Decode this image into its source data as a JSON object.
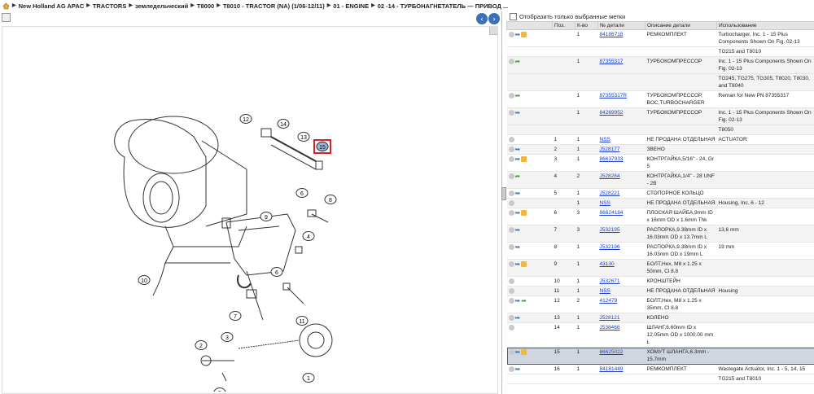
{
  "breadcrumb": [
    "New Holland AG APAC",
    "TRACTORS",
    "земледельческий",
    "T8000",
    "T8010 - TRACTOR (NA) (1/06-12/11)",
    "01 - ENGINE",
    "02 -14 - ТУРБОНАГНЕТАТЕЛЬ — ПРИВОД ..."
  ],
  "filter_label": "Отобразить только выбранные метки",
  "columns": [
    "",
    "Поз.",
    "К-во",
    "№ детали",
    "Описание детали",
    "Использование"
  ],
  "colors": {
    "selected_border": "#e02020",
    "link": "#1a3fd1",
    "nav_btn": "#3b6fb6"
  },
  "rows": [
    {
      "icons": [
        "circle",
        "arrow",
        "cart"
      ],
      "pos": "",
      "qty": "1",
      "part": "84186718",
      "desc": "РЕМКОМПЛЕКТ",
      "use": "Turbocharger, Inc. 1 - 15 Plus Components Shown On Fig. 02-13"
    },
    {
      "icons": [],
      "pos": "",
      "qty": "",
      "part": "",
      "desc": "",
      "use": "TG215 and T8010"
    },
    {
      "icons": [
        "circle",
        "garrow"
      ],
      "pos": "",
      "qty": "1",
      "part": "87355317",
      "desc": "ТУРБОКОМПРЕССОР",
      "use": "Inc. 1 - 15 Plus Components Shown On Fig. 02-13"
    },
    {
      "icons": [],
      "pos": "",
      "qty": "",
      "part": "",
      "desc": "",
      "use": "TG245, TG275, TG305, T8020, T8030, and T8040"
    },
    {
      "icons": [
        "circle",
        "garrow"
      ],
      "pos": "",
      "qty": "1",
      "part": "87355317R",
      "desc": "ТУРБОКОМПРЕССОР, BOC,TURBOCHARGER",
      "use": "Reman for New PN 87355317"
    },
    {
      "icons": [
        "circle",
        "arrow"
      ],
      "pos": "",
      "qty": "1",
      "part": "84269952",
      "desc": "ТУРБОКОМПРЕССОР",
      "use": "Inc. 1 - 15 Plus Components Shown On Fig. 02-13"
    },
    {
      "icons": [],
      "pos": "",
      "qty": "",
      "part": "",
      "desc": "",
      "use": "T8050"
    },
    {
      "icons": [
        "circle"
      ],
      "pos": "1",
      "qty": "1",
      "part": "NSS",
      "desc": "НЕ ПРОДАНА ОТДЕЛЬНАЯ",
      "use": "ACTUATOR"
    },
    {
      "icons": [
        "circle",
        "arrow"
      ],
      "pos": "2",
      "qty": "1",
      "part": "J528177",
      "desc": "ЗВЕНО",
      "use": ""
    },
    {
      "icons": [
        "circle",
        "arrow",
        "cart"
      ],
      "pos": "3",
      "qty": "1",
      "part": "86637933",
      "desc": "КОНТРГАЙКА,5/16\" - 24, Gr 5",
      "use": ""
    },
    {
      "icons": [
        "circle",
        "garrow"
      ],
      "pos": "4",
      "qty": "2",
      "part": "J528284",
      "desc": "КОНТРГАЙКА,1/4\" - 28 UNF - 2B",
      "use": ""
    },
    {
      "icons": [
        "circle",
        "arrow"
      ],
      "pos": "5",
      "qty": "1",
      "part": "J528221",
      "desc": "СТОПОРНОЕ КОЛЬЦО",
      "use": ""
    },
    {
      "icons": [
        "circle"
      ],
      "pos": "",
      "qty": "1",
      "part": "NSS",
      "desc": "НЕ ПРОДАНА ОТДЕЛЬНАЯ",
      "use": "Housing, Inc. 6 - 12"
    },
    {
      "icons": [
        "circle",
        "arrow",
        "cart"
      ],
      "pos": "6",
      "qty": "3",
      "part": "86624184",
      "desc": "ПЛОСКАЯ ШАЙБА,9mm ID x 16mm OD x 1.6mm Thk",
      "use": ""
    },
    {
      "icons": [
        "circle",
        "arrow"
      ],
      "pos": "7",
      "qty": "3",
      "part": "J532195",
      "desc": "РАСПОРКА,9.38mm ID x 16.03mm OD x 13.7mm L",
      "use": "13,6 mm"
    },
    {
      "icons": [
        "circle",
        "arrow"
      ],
      "pos": "8",
      "qty": "1",
      "part": "J532196",
      "desc": "РАСПОРКА,9.38mm ID x 16.03mm OD x 19mm L",
      "use": "19 mm"
    },
    {
      "icons": [
        "circle",
        "arrow",
        "cart"
      ],
      "pos": "9",
      "qty": "1",
      "part": "43130",
      "desc": "БОЛТ,Hex, M8 x 1.25 x 50mm, Cl 8.8",
      "use": ""
    },
    {
      "icons": [
        "circle"
      ],
      "pos": "10",
      "qty": "1",
      "part": "J532671",
      "desc": "КРОНШТЕЙН",
      "use": ""
    },
    {
      "icons": [
        "circle"
      ],
      "pos": "11",
      "qty": "1",
      "part": "NSS",
      "desc": "НЕ ПРОДАНА ОТДЕЛЬНАЯ",
      "use": "Housing"
    },
    {
      "icons": [
        "circle",
        "arrow",
        "garrow"
      ],
      "pos": "12",
      "qty": "2",
      "part": "412479",
      "desc": "БОЛТ,Hex, M8 x 1.25 x 35mm, Cl 8.8",
      "use": ""
    },
    {
      "icons": [
        "circle",
        "arrow"
      ],
      "pos": "13",
      "qty": "1",
      "part": "J528121",
      "desc": "КОЛЕНО",
      "use": ""
    },
    {
      "icons": [
        "circle"
      ],
      "pos": "14",
      "qty": "1",
      "part": "J538468",
      "desc": "ШЛАНГ,6.60mm ID x 12.05mm OD x 1000.00 mm L",
      "use": ""
    },
    {
      "icons": [
        "circle",
        "arrow",
        "cart"
      ],
      "pos": "15",
      "qty": "1",
      "part": "86625022",
      "desc": "ХОМУТ ШЛАНГА,6.3mm - 15.7mm",
      "use": "",
      "selected": true
    },
    {
      "icons": [
        "circle",
        "arrow"
      ],
      "pos": "16",
      "qty": "1",
      "part": "84181449",
      "desc": "РЕМКОМПЛЕКТ",
      "use": "Wastegate Actuator, Inc. 1 - 5, 14, 15"
    },
    {
      "icons": [],
      "pos": "",
      "qty": "",
      "part": "",
      "desc": "",
      "use": "TG215 and T8010"
    }
  ],
  "callouts": [
    "1",
    "2",
    "3",
    "4",
    "5",
    "6",
    "6",
    "7",
    "8",
    "9",
    "10",
    "11",
    "12",
    "13",
    "14",
    "15",
    "15"
  ]
}
